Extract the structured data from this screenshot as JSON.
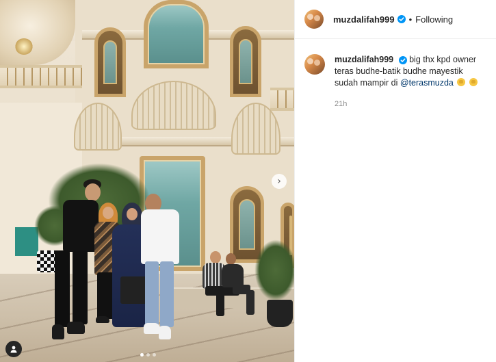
{
  "post": {
    "author": "muzdalifah999",
    "separator": "•",
    "follow_state": "Following",
    "verified_icon": "verified-badge-icon",
    "accent_color": "#0095f6"
  },
  "caption": {
    "username": "muzdalifah999",
    "text": "big thx kpd owner teras budhe-batik budhe mayestik sudah mampir di",
    "mention": "@terasmuzda",
    "emojis": [
      "hands-emoji-icon",
      "hands-emoji-icon"
    ],
    "timestamp": "21h"
  },
  "carousel": {
    "next_icon": "chevron-right-icon",
    "tag_icon": "user-tag-icon",
    "slide_count": 3,
    "active_slide": 1,
    "next_glyph": "›"
  }
}
